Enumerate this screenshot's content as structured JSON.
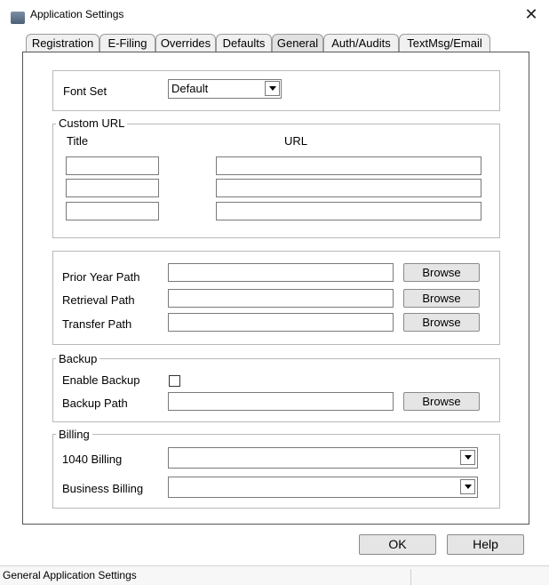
{
  "window": {
    "title": "Application Settings",
    "icon": "app-window-icon",
    "close_glyph": "✕"
  },
  "tabs": [
    {
      "label": "Registration",
      "active": false
    },
    {
      "label": "E-Filing",
      "active": false
    },
    {
      "label": "Overrides",
      "active": false
    },
    {
      "label": "Defaults",
      "active": false
    },
    {
      "label": "General",
      "active": true
    },
    {
      "label": "Auth/Audits",
      "active": false
    },
    {
      "label": "TextMsg/Email",
      "active": false
    }
  ],
  "font_set": {
    "label": "Font Set",
    "value": "Default"
  },
  "custom_url": {
    "legend": "Custom URL",
    "title_header": "Title",
    "url_header": "URL",
    "rows": [
      {
        "title": "",
        "url": ""
      },
      {
        "title": "",
        "url": ""
      },
      {
        "title": "",
        "url": ""
      }
    ]
  },
  "paths": {
    "prior_year": {
      "label": "Prior Year Path",
      "value": "",
      "button": "Browse"
    },
    "retrieval": {
      "label": "Retrieval Path",
      "value": "",
      "button": "Browse"
    },
    "transfer": {
      "label": "Transfer Path",
      "value": "",
      "button": "Browse"
    }
  },
  "backup": {
    "legend": "Backup",
    "enable_label": "Enable Backup",
    "enabled": false,
    "path_label": "Backup Path",
    "path_value": "",
    "button": "Browse"
  },
  "billing": {
    "legend": "Billing",
    "form_1040_label": "1040 Billing",
    "form_1040_value": "",
    "business_label": "Business Billing",
    "business_value": ""
  },
  "footer": {
    "ok": "OK",
    "help": "Help"
  },
  "status": {
    "text": "General Application Settings"
  }
}
